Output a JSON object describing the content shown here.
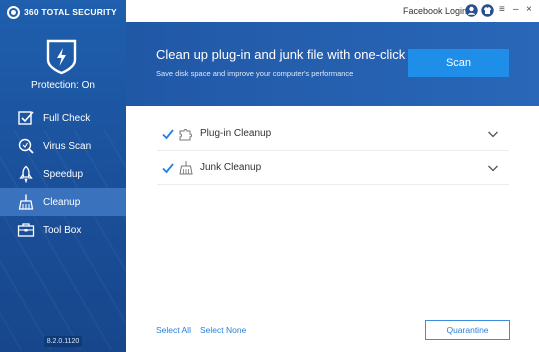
{
  "app": {
    "logo_text": "360 TOTAL SECURITY",
    "version": "8.2.0.1120"
  },
  "status": {
    "label": "Protection: On"
  },
  "sidebar": {
    "items": [
      {
        "label": "Full Check",
        "icon": "checkbox-icon"
      },
      {
        "label": "Virus Scan",
        "icon": "search-icon"
      },
      {
        "label": "Speedup",
        "icon": "rocket-icon"
      },
      {
        "label": "Cleanup",
        "icon": "broom-icon",
        "active": true
      },
      {
        "label": "Tool Box",
        "icon": "toolbox-icon"
      }
    ]
  },
  "topbar": {
    "login_label": "Facebook Login",
    "minimize": "–",
    "close": "×",
    "menu": "≡"
  },
  "banner": {
    "title": "Clean up plug-in and junk file with one-click",
    "subtitle": "Save disk space and improve your computer's performance",
    "scan_label": "Scan"
  },
  "cleanup_items": [
    {
      "label": "Plug-in Cleanup",
      "checked": true,
      "icon": "puzzle-icon"
    },
    {
      "label": "Junk Cleanup",
      "checked": true,
      "icon": "broom-icon"
    }
  ],
  "footer": {
    "select_all": "Select All",
    "select_none": "Select None",
    "quarantine": "Quarantine"
  },
  "colors": {
    "sidebar": "#1f5fae",
    "active_item": "#3a72bd",
    "banner": "#2058a6",
    "scan_button": "#1e8ee8",
    "link": "#2a80d8"
  }
}
